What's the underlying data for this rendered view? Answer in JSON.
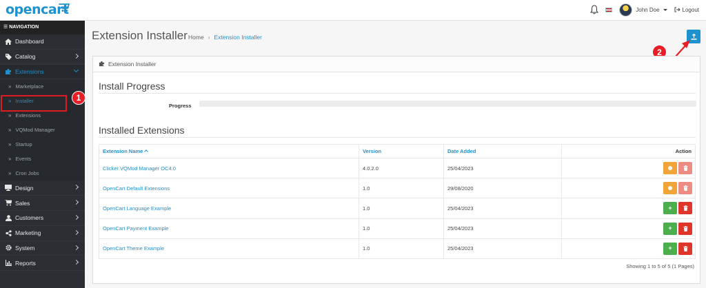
{
  "header": {
    "logo": "opencart",
    "user_name": "John Doe",
    "logout_label": "Logout"
  },
  "sidebar": {
    "title": "NAVIGATION",
    "items": [
      {
        "label": "Dashboard",
        "icon": "home-icon"
      },
      {
        "label": "Catalog",
        "icon": "tag-icon"
      },
      {
        "label": "Extensions",
        "icon": "puzzle-icon"
      }
    ],
    "sub_items": [
      "Marketplace",
      "Installer",
      "Extensions",
      "VQMod Manager",
      "Startup",
      "Events",
      "Cron Jobs"
    ],
    "items_after": [
      {
        "label": "Design",
        "icon": "monitor-icon"
      },
      {
        "label": "Sales",
        "icon": "cart-icon"
      },
      {
        "label": "Customers",
        "icon": "user-icon"
      },
      {
        "label": "Marketing",
        "icon": "share-icon"
      },
      {
        "label": "System",
        "icon": "gear-icon"
      },
      {
        "label": "Reports",
        "icon": "bar-chart-icon"
      }
    ]
  },
  "page": {
    "title": "Extension Installer",
    "breadcrumb_home": "Home",
    "breadcrumb_current": "Extension Installer",
    "panel_title": "Extension Installer",
    "install_progress_title": "Install Progress",
    "progress_label": "Progress",
    "progress_value": 0,
    "installed_title": "Installed Extensions"
  },
  "table": {
    "headers": [
      "Extension Name",
      "Version",
      "Date Added",
      "Action"
    ],
    "rows": [
      {
        "name": "Clicker VQMod Manager OC4.0",
        "version": "4.0.2.0",
        "date": "25/04/2023",
        "installed": false
      },
      {
        "name": "OpenCart Default Extensions",
        "version": "1.0",
        "date": "29/08/2020",
        "installed": false
      },
      {
        "name": "OpenCart Language Example",
        "version": "1.0",
        "date": "25/04/2023",
        "installed": true
      },
      {
        "name": "OpenCart Payment Example",
        "version": "1.0",
        "date": "25/04/2023",
        "installed": true
      },
      {
        "name": "OpenCart Theme Example",
        "version": "1.0",
        "date": "25/04/2023",
        "installed": true
      }
    ],
    "footer": "Showing 1 to 5 of 5 (1 Pages)"
  },
  "annotations": {
    "badge_1": "1",
    "badge_2": "2"
  },
  "colors": {
    "accent": "#1e91cf",
    "annotation_red": "#e61e25",
    "warning": "#f0a439",
    "success": "#4cae4c",
    "danger": "#e0352b"
  }
}
